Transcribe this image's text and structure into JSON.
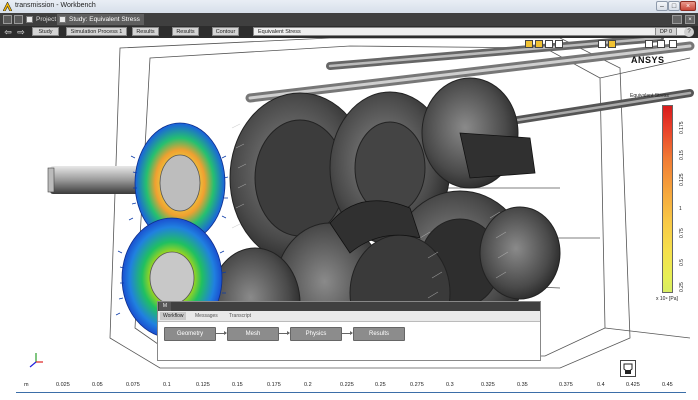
{
  "window": {
    "title": "transmission - Workbench",
    "buttons": [
      "–",
      "□",
      "×"
    ]
  },
  "tabs": [
    {
      "label": "Project",
      "active": false
    },
    {
      "label": "Study: Equivalent Stress",
      "active": true
    }
  ],
  "breadcrumbs": [
    "Study",
    "Simulation Process 1",
    "Results",
    "Results",
    "Contour",
    "Equivalent Stress"
  ],
  "dp_label": "DP 0",
  "help_label": "?",
  "viewport": {
    "brand": "ANSYS",
    "legend": {
      "title": "Equivalent Stress",
      "ticks": [
        "0.175",
        "0.15",
        "0.125",
        "1",
        "0.75",
        "0.5",
        "0.25"
      ],
      "units": "x 10⁹ [Pa]",
      "colors": {
        "high": "#d81b1b",
        "mid": "#f5a33c",
        "low": "#d8ee62"
      }
    },
    "ruler": {
      "labels": [
        "m",
        "0.025",
        "0.05",
        "0.075",
        "0.1",
        "0.125",
        "0.15",
        "0.175",
        "0.2",
        "0.225",
        "0.25",
        "0.275",
        "0.3",
        "0.325",
        "0.35",
        "0.375",
        "0.4",
        "0.425",
        "0.45"
      ]
    }
  },
  "panel": {
    "menu_label": "M",
    "tabs": [
      {
        "label": "Workflow",
        "active": true
      },
      {
        "label": "Messages",
        "active": false
      },
      {
        "label": "Transcript",
        "active": false
      }
    ],
    "workflow_steps": [
      "Geometry",
      "Mesh",
      "Physics",
      "Results"
    ]
  },
  "icons": [
    "ansys-logo-icon",
    "back-arrow-icon",
    "forward-arrow-icon",
    "view-toolbar-icon",
    "axis-triad-icon",
    "fit-view-icon"
  ],
  "colors": {
    "accent": "#3b6ea8",
    "workflow_step": "#8c8c8c",
    "toolbar": "#2d2d2d"
  }
}
